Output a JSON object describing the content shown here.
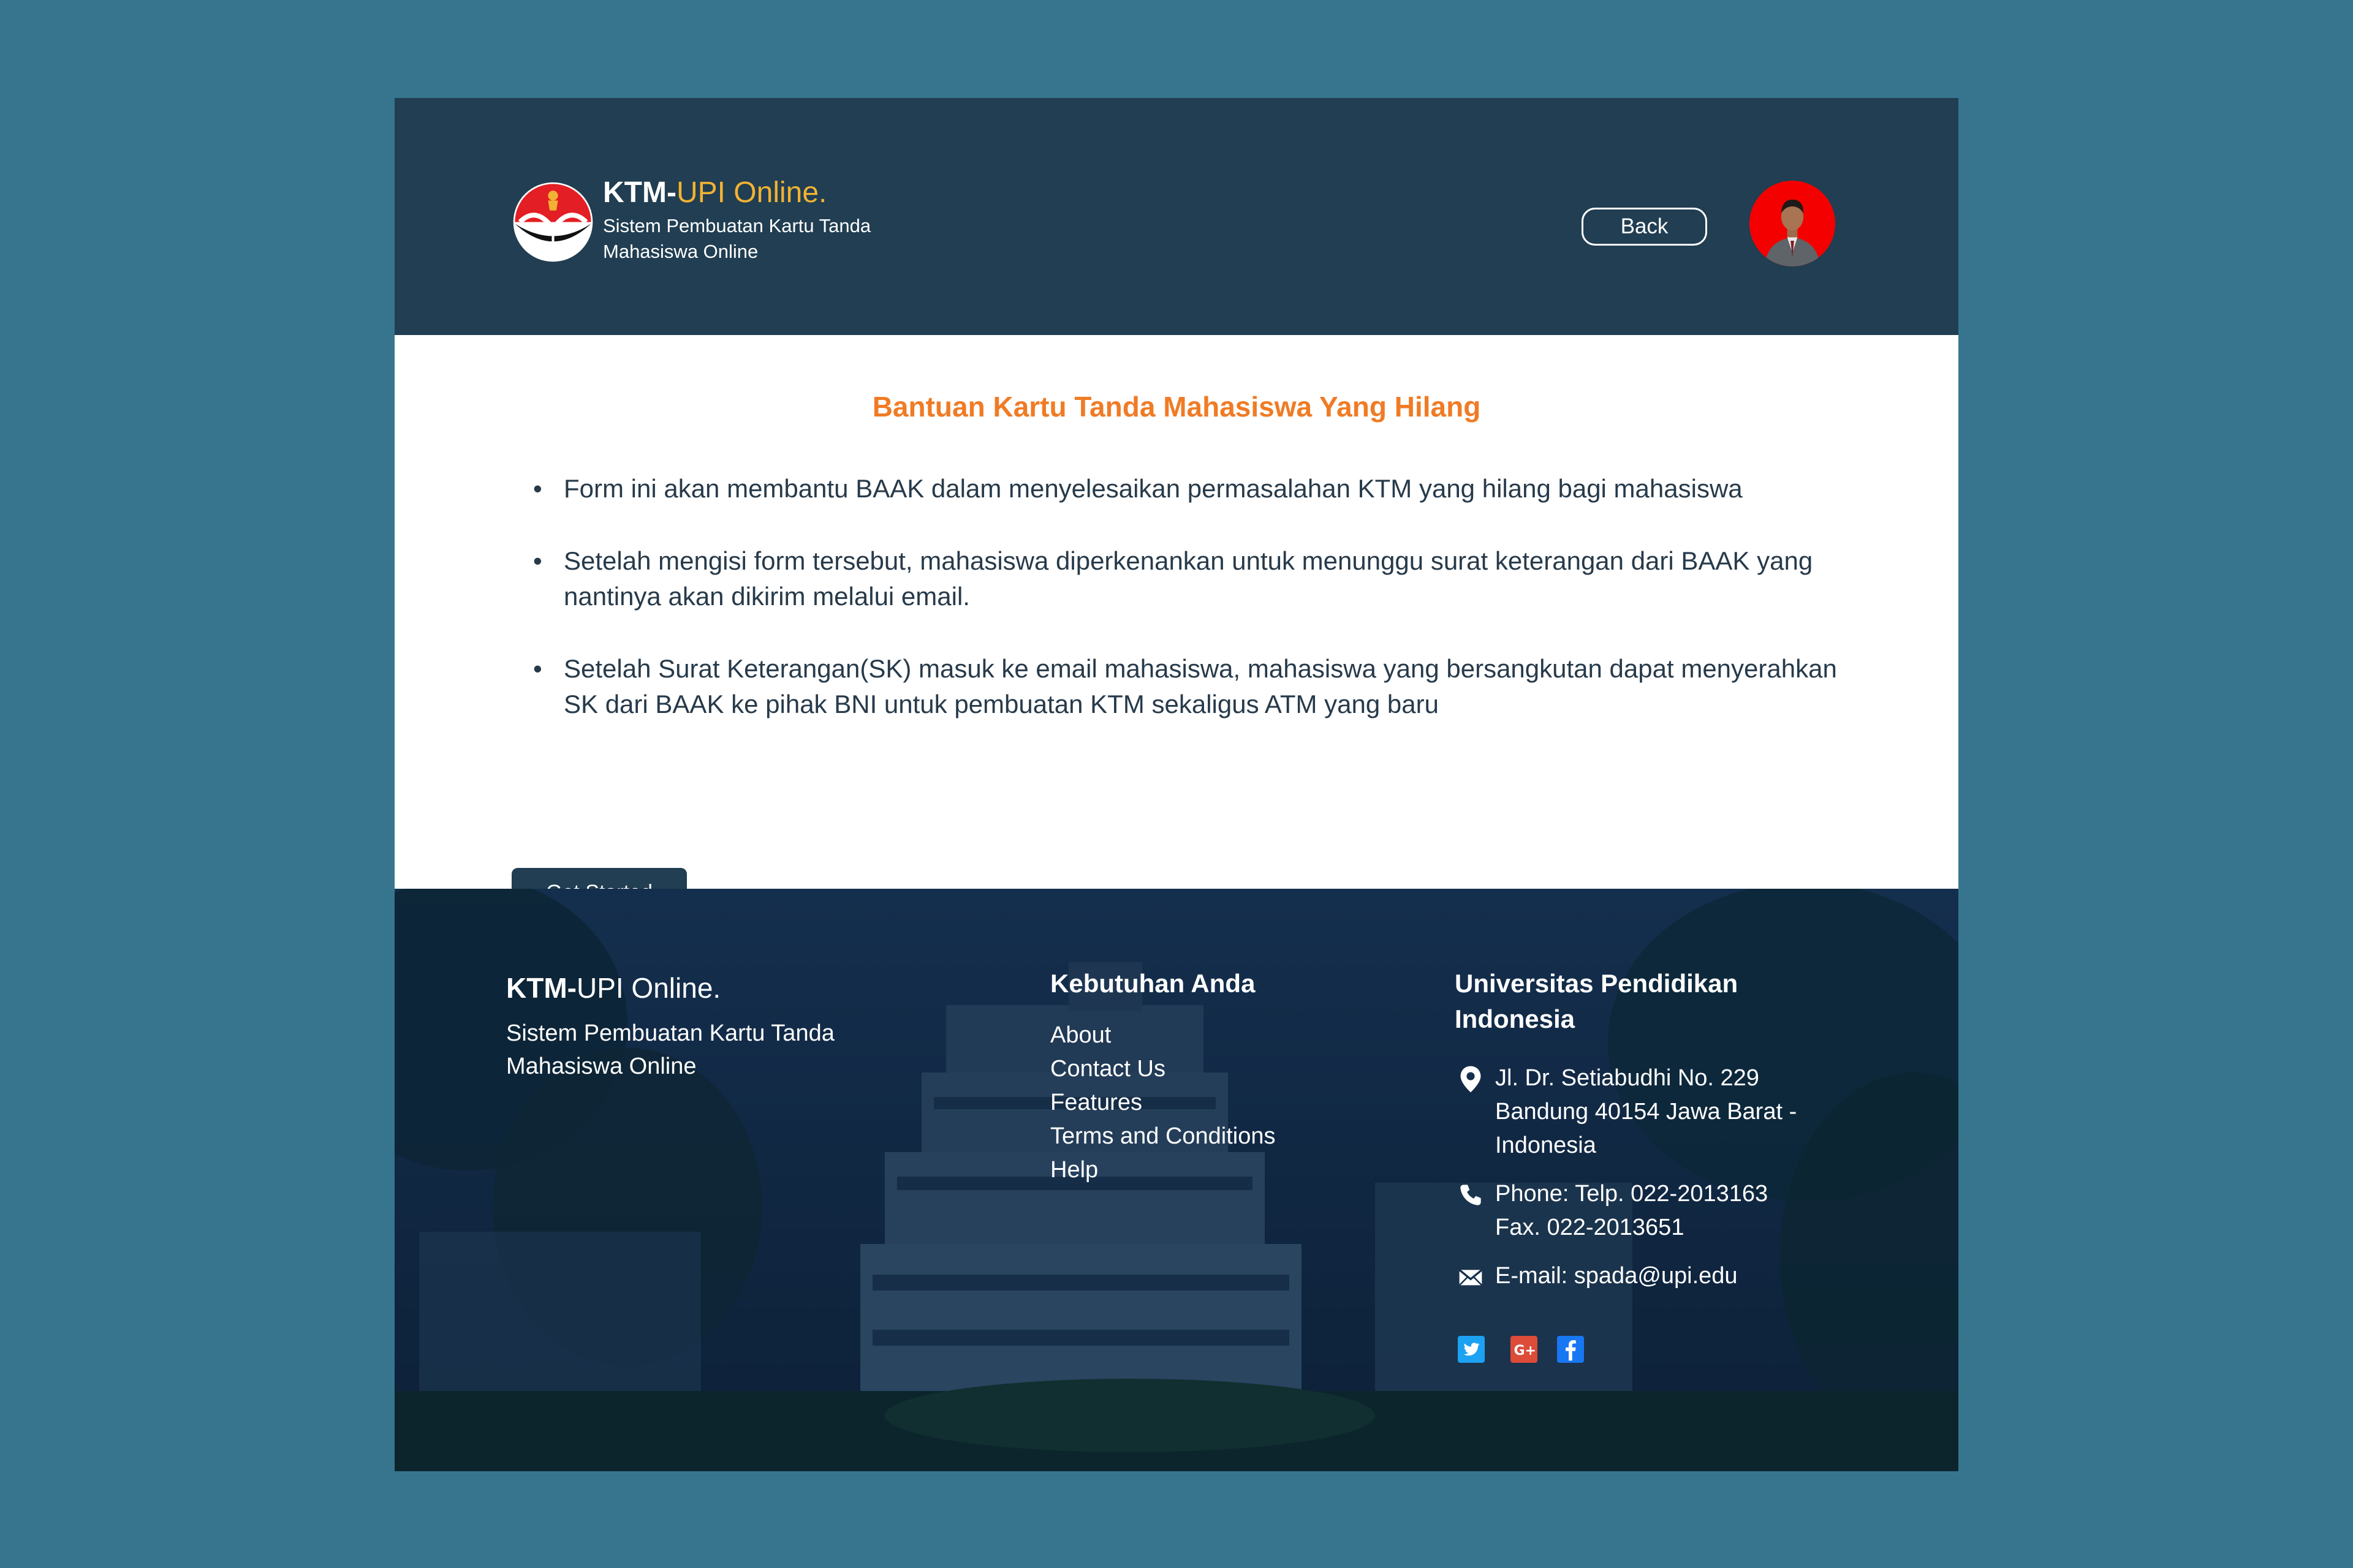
{
  "header": {
    "brand_strong": "KTM-",
    "brand_light": "UPI Online.",
    "brand_sub": "Sistem Pembuatan Kartu Tanda Mahasiswa Online",
    "back_label": "Back"
  },
  "main": {
    "title": "Bantuan Kartu Tanda Mahasiswa Yang Hilang",
    "bullets": [
      "Form ini akan membantu BAAK dalam menyelesaikan permasalahan KTM yang hilang bagi mahasiswa",
      "Setelah mengisi form tersebut, mahasiswa diperkenankan untuk menunggu surat keterangan dari BAAK yang nantinya akan dikirim melalui email.",
      "Setelah Surat Keterangan(SK) masuk ke email mahasiswa, mahasiswa yang bersangkutan dapat menyerahkan SK dari BAAK ke pihak BNI untuk pembuatan KTM sekaligus ATM yang baru"
    ],
    "cta_label": "Get Started"
  },
  "footer": {
    "brand_strong": "KTM-",
    "brand_light": "UPI Online.",
    "brand_sub": "Sistem Pembuatan Kartu Tanda Mahasiswa Online",
    "links_heading": "Kebutuhan Anda",
    "links": [
      "About",
      "Contact Us",
      "Features",
      "Terms and Conditions",
      "Help"
    ],
    "contact_heading": "Universitas Pendidikan Indonesia",
    "address": "Jl. Dr. Setiabudhi No. 229 Bandung 40154 Jawa Barat - Indonesia",
    "phone": "Phone: Telp. 022-2013163",
    "fax": "Fax. 022-2013651",
    "email": "E-mail: spada@upi.edu",
    "socials": [
      "twitter-icon",
      "google-plus-icon",
      "facebook-icon"
    ]
  },
  "colors": {
    "page_bg": "#37758f",
    "header_bg": "#213e52",
    "accent_orange": "#f07b25",
    "brand_gold": "#f2b233",
    "avatar_red": "#f40000"
  }
}
